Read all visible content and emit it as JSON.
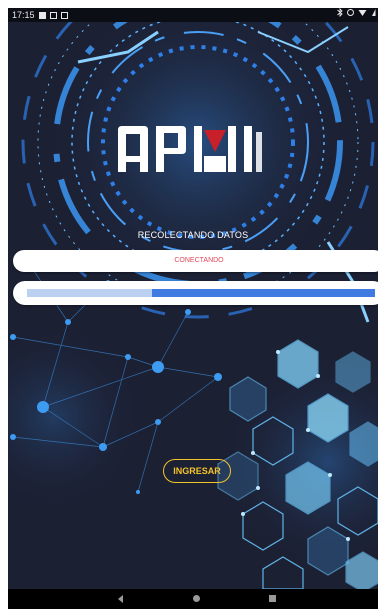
{
  "status_bar": {
    "time": "17:15",
    "left_icons": [
      "image-icon",
      "mail-icon",
      "mail-icon"
    ],
    "right_icons": [
      "bluetooth-icon",
      "sync-icon",
      "wifi-icon",
      "battery-icon"
    ]
  },
  "app": {
    "logo_text": "OPMI",
    "title": "RECOLECTANDO DATOS",
    "status": "CONECTANDO",
    "progress": 0.36,
    "button_label": "INGRESAR"
  },
  "nav_bar": {
    "icons": [
      "back-icon",
      "home-icon",
      "recents-icon"
    ]
  },
  "colors": {
    "background": "#1c2033",
    "status_text": "#e0495a",
    "progress_track": "#bcd0f2",
    "progress_fill": "#3f7be0",
    "button_accent": "#f3c32c",
    "logo_red": "#c8202a",
    "hexagon": "#5fb2e6"
  }
}
